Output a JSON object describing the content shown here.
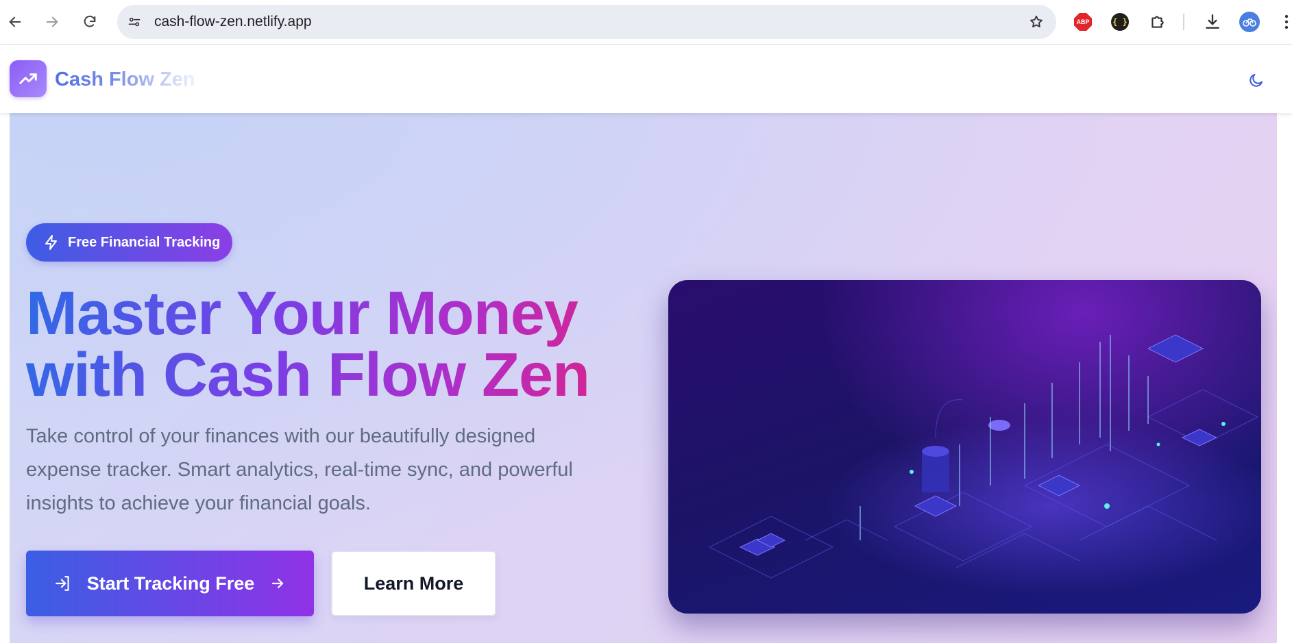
{
  "browser": {
    "url": "cash-flow-zen.netlify.app",
    "extensions": [
      "adblock-plus",
      "json-viewer",
      "extensions"
    ],
    "abp_label": "ABP",
    "braces_label": "{ }"
  },
  "header": {
    "brand": "Cash Flow Zen",
    "brand_icon": "trending-up-icon",
    "theme_toggle_icon": "moon-icon"
  },
  "hero": {
    "badge": "Free Financial Tracking",
    "badge_icon": "lightning-icon",
    "headline_line1": "Master Your Money",
    "headline_line2": "with Cash Flow Zen",
    "description": "Take control of your finances with our beautifully designed expense tracker. Smart analytics, real-time sync, and powerful insights to achieve your financial goals.",
    "primary_button": "Start Tracking Free",
    "secondary_button": "Learn More",
    "image": "isometric-data-city-illustration"
  },
  "colors": {
    "brand_purple": "#8b5cf6",
    "gradient_start": "#3a5ee4",
    "gradient_end": "#9032e6",
    "headline_pink": "#e0227f"
  }
}
